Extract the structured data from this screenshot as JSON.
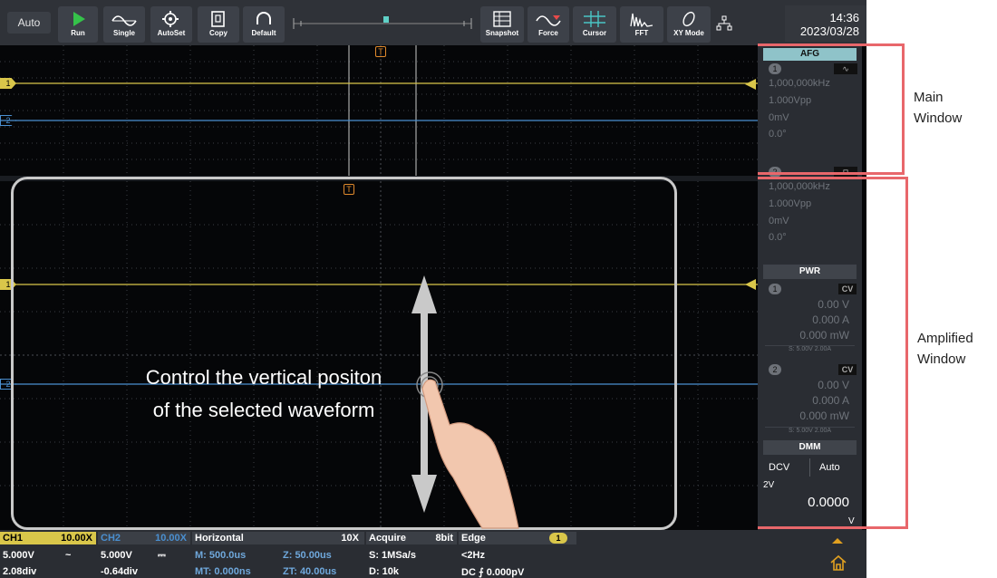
{
  "toolbar": {
    "mode": "Auto",
    "buttons": [
      {
        "label": "Run",
        "icon": "play-icon"
      },
      {
        "label": "Single",
        "icon": "single-wave-icon"
      },
      {
        "label": "AutoSet",
        "icon": "autoset-gear-icon"
      },
      {
        "label": "Copy",
        "icon": "copy-icon"
      },
      {
        "label": "Default",
        "icon": "default-reset-icon"
      },
      {
        "label": "Snapshot",
        "icon": "snapshot-icon"
      },
      {
        "label": "Force",
        "icon": "force-wave-icon"
      },
      {
        "label": "Cursor",
        "icon": "cursor-icon"
      },
      {
        "label": "FFT",
        "icon": "fft-icon"
      },
      {
        "label": "XY Mode",
        "icon": "xy-mode-icon"
      }
    ],
    "time": "14:36",
    "date": "2023/03/28"
  },
  "markers": {
    "trigger": "T",
    "ch1": "1",
    "ch2": "2"
  },
  "afg": {
    "title": "AFG",
    "ch1": {
      "num": "1",
      "freq": "1,000,000kHz",
      "amp": "1.000Vpp",
      "offset": "0mV",
      "phase": "0.0°"
    },
    "ch2": {
      "num": "2",
      "freq": "1,000,000kHz",
      "amp": "1.000Vpp",
      "offset": "0mV",
      "phase": "0.0°"
    }
  },
  "pwr": {
    "title": "PWR",
    "ch1": {
      "num": "1",
      "mode": "CV",
      "v": "0.00 V",
      "a": "0.000 A",
      "w": "0.000 mW",
      "set": "S: 5.00V 2.00A"
    },
    "ch2": {
      "num": "2",
      "mode": "CV",
      "v": "0.00 V",
      "a": "0.000 A",
      "w": "0.000 mW",
      "set": "S: 5.00V 2.00A"
    }
  },
  "dmm": {
    "title": "DMM",
    "func": "DCV",
    "range_mode": "Auto",
    "range": "2V",
    "value": "0.0000",
    "unit": "V"
  },
  "bottom": {
    "ch1": {
      "name": "CH1",
      "probe": "10.00X",
      "scale": "5.000V",
      "coupling": "~",
      "pos": "2.08div"
    },
    "ch2": {
      "name": "CH2",
      "probe": "10.00X",
      "scale": "5.000V",
      "coupling": "⎓",
      "pos": "-0.64div"
    },
    "horizontal": {
      "title": "Horizontal",
      "zoom": "10X",
      "m": "M: 500.0us",
      "z": "Z: 50.00us",
      "mt": "MT: 0.000ns",
      "zt": "ZT: 40.00us"
    },
    "acquire": {
      "title": "Acquire",
      "bits": "8bit",
      "s": "S: 1MSa/s",
      "d": "D: 10k"
    },
    "trigger": {
      "title": "Edge",
      "src": "1",
      "freq": "<2Hz",
      "level": "DC ⨍ 0.000pV"
    }
  },
  "annotations": {
    "main": [
      "Main",
      "Window"
    ],
    "amplified": [
      "Amplified",
      "Window"
    ],
    "overlay": [
      "Control the vertical positon",
      "of the selected waveform"
    ]
  },
  "colors": {
    "ch1": "#d9c64a",
    "ch2": "#4a8fd0",
    "afg_head": "#8fc3c9",
    "highlight": "#e8676b",
    "trigger": "#e08a2c",
    "run": "#35c24a"
  }
}
